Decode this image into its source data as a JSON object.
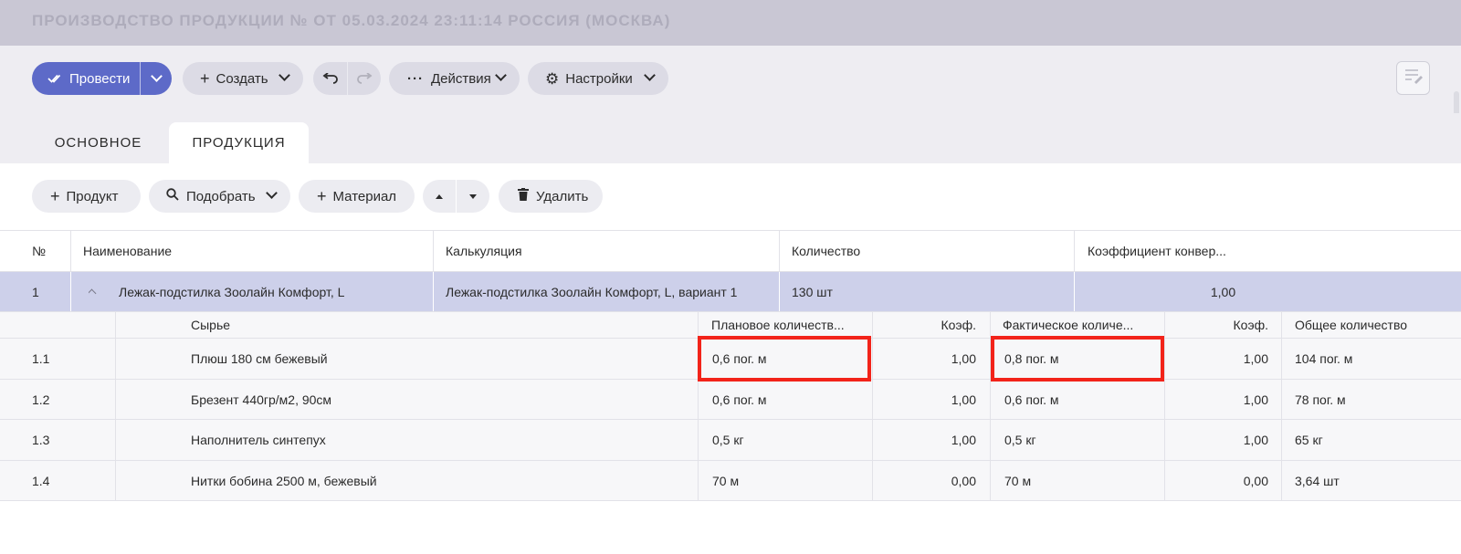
{
  "window": {
    "title": "ПРОИЗВОДСТВО ПРОДУКЦИИ № ОТ 05.03.2024 23:11:14 РОССИЯ (МОСКВА)"
  },
  "toolbar": {
    "conduct_label": "Провести",
    "create_label": "Создать",
    "actions_label": "Действия",
    "settings_label": "Настройки"
  },
  "tabs": [
    {
      "label": "ОСНОВНОЕ",
      "active": false
    },
    {
      "label": "ПРОДУКЦИЯ",
      "active": true
    }
  ],
  "product_actions": {
    "add_product_label": "Продукт",
    "pick_label": "Подобрать",
    "add_material_label": "Материал",
    "delete_label": "Удалить"
  },
  "products_table": {
    "headers": [
      "№",
      "Наименование",
      "Калькуляция",
      "Количество",
      "Коэффициент конвер..."
    ],
    "rows": [
      {
        "num": "1",
        "name": "Лежак-подстилка Зоолайн Комфорт, L",
        "calculation": "Лежак-подстилка Зоолайн Комфорт, L, вариант 1",
        "quantity": "130 шт",
        "coefficient": "1,00"
      }
    ]
  },
  "materials_table": {
    "headers": [
      "Сырье",
      "Плановое количеств...",
      "Коэф.",
      "Фактическое количе...",
      "Коэф.",
      "Общее количество"
    ],
    "rows": [
      {
        "num": "1.1",
        "material": "Плюш 180 см бежевый",
        "planned": "0,6 пог. м",
        "coef1": "1,00",
        "actual": "0,8 пог. м",
        "coef2": "1,00",
        "total": "104 пог. м"
      },
      {
        "num": "1.2",
        "material": "Брезент 440гр/м2, 90см",
        "planned": "0,6 пог. м",
        "coef1": "1,00",
        "actual": "0,6 пог. м",
        "coef2": "1,00",
        "total": "78 пог. м"
      },
      {
        "num": "1.3",
        "material": "Наполнитель синтепух",
        "planned": "0,5 кг",
        "coef1": "1,00",
        "actual": "0,5 кг",
        "coef2": "1,00",
        "total": "65 кг"
      },
      {
        "num": "1.4",
        "material": "Нитки бобина 2500 м, бежевый",
        "planned": "70 м",
        "coef1": "0,00",
        "actual": "70 м",
        "coef2": "0,00",
        "total": "3,64 шт"
      }
    ]
  },
  "colors": {
    "primary": "#5d6ac8",
    "selected_row": "#cdd0ea",
    "highlight": "#f2231a",
    "titlebar": "#c9c7d4"
  }
}
